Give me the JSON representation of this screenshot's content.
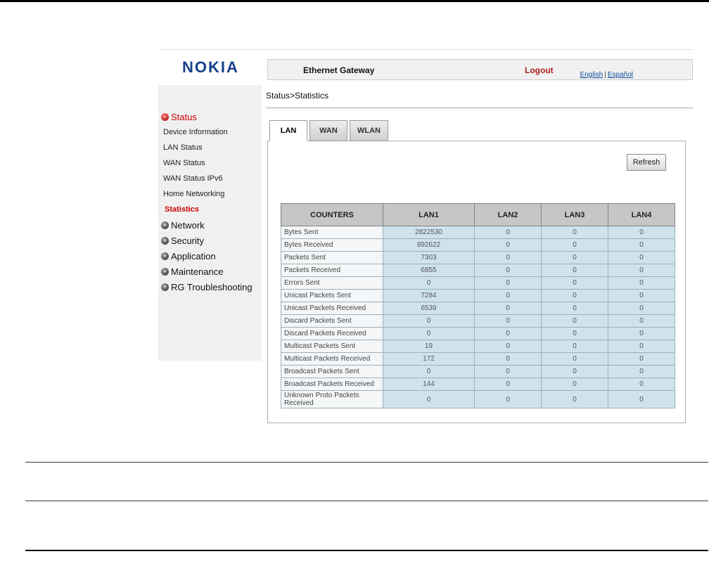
{
  "colors": {
    "nokia_blue": "#16418c",
    "logout_red": "#b01c1c",
    "active_item_red": "#cc0000",
    "table_header_bg": "#c6c6c6",
    "table_value_bg": "#cfe3ee",
    "sidebar_bg": "#f0f0f0"
  },
  "header": {
    "logo": "NOKIA",
    "title": "Ethernet Gateway",
    "logout_label": "Logout",
    "language_links": [
      "English",
      "Español"
    ],
    "language_separator": "|"
  },
  "breadcrumb": "Status>Statistics",
  "sidebar": {
    "items": [
      {
        "label": "Status",
        "kind": "root",
        "icon": "minus-ball"
      },
      {
        "label": "Device Information",
        "kind": "sub"
      },
      {
        "label": "LAN Status",
        "kind": "sub"
      },
      {
        "label": "WAN Status",
        "kind": "sub"
      },
      {
        "label": "WAN Status IPv6",
        "kind": "sub"
      },
      {
        "label": "Home Networking",
        "kind": "sub"
      },
      {
        "label": "Statistics",
        "kind": "sub-active"
      },
      {
        "label": "Network",
        "kind": "section",
        "icon": "plus-ball"
      },
      {
        "label": "Security",
        "kind": "section",
        "icon": "plus-ball"
      },
      {
        "label": "Application",
        "kind": "section",
        "icon": "plus-ball"
      },
      {
        "label": "Maintenance",
        "kind": "section",
        "icon": "plus-ball"
      },
      {
        "label": "RG Troubleshooting",
        "kind": "section",
        "icon": "plus-ball"
      }
    ]
  },
  "tabs": [
    {
      "label": "LAN",
      "active": true
    },
    {
      "label": "WAN",
      "active": false
    },
    {
      "label": "WLAN",
      "active": false
    }
  ],
  "toolbar": {
    "refresh_label": "Refresh"
  },
  "table": {
    "headers": [
      "COUNTERS",
      "LAN1",
      "LAN2",
      "LAN3",
      "LAN4"
    ],
    "rows": [
      {
        "label": "Bytes Sent",
        "values": [
          "2822530",
          "0",
          "0",
          "0"
        ]
      },
      {
        "label": "Bytes Received",
        "values": [
          "892622",
          "0",
          "0",
          "0"
        ]
      },
      {
        "label": "Packets Sent",
        "values": [
          "7303",
          "0",
          "0",
          "0"
        ]
      },
      {
        "label": "Packets Received",
        "values": [
          "6855",
          "0",
          "0",
          "0"
        ]
      },
      {
        "label": "Errors Sent",
        "values": [
          "0",
          "0",
          "0",
          "0"
        ]
      },
      {
        "label": "Unicast Packets Sent",
        "values": [
          "7284",
          "0",
          "0",
          "0"
        ]
      },
      {
        "label": "Unicast Packets Received",
        "values": [
          "6539",
          "0",
          "0",
          "0"
        ]
      },
      {
        "label": "Discard Packets Sent",
        "values": [
          "0",
          "0",
          "0",
          "0"
        ]
      },
      {
        "label": "Discard Packets Received",
        "values": [
          "0",
          "0",
          "0",
          "0"
        ]
      },
      {
        "label": "Multicast Packets Sent",
        "values": [
          "19",
          "0",
          "0",
          "0"
        ]
      },
      {
        "label": "Multicast Packets Received",
        "values": [
          "172",
          "0",
          "0",
          "0"
        ]
      },
      {
        "label": "Broadcast Packets Sent",
        "values": [
          "0",
          "0",
          "0",
          "0"
        ]
      },
      {
        "label": "Broadcast Packets Received",
        "values": [
          "144",
          "0",
          "0",
          "0"
        ]
      },
      {
        "label": "Unknown Proto Packets Received",
        "values": [
          "0",
          "0",
          "0",
          "0"
        ]
      }
    ]
  }
}
